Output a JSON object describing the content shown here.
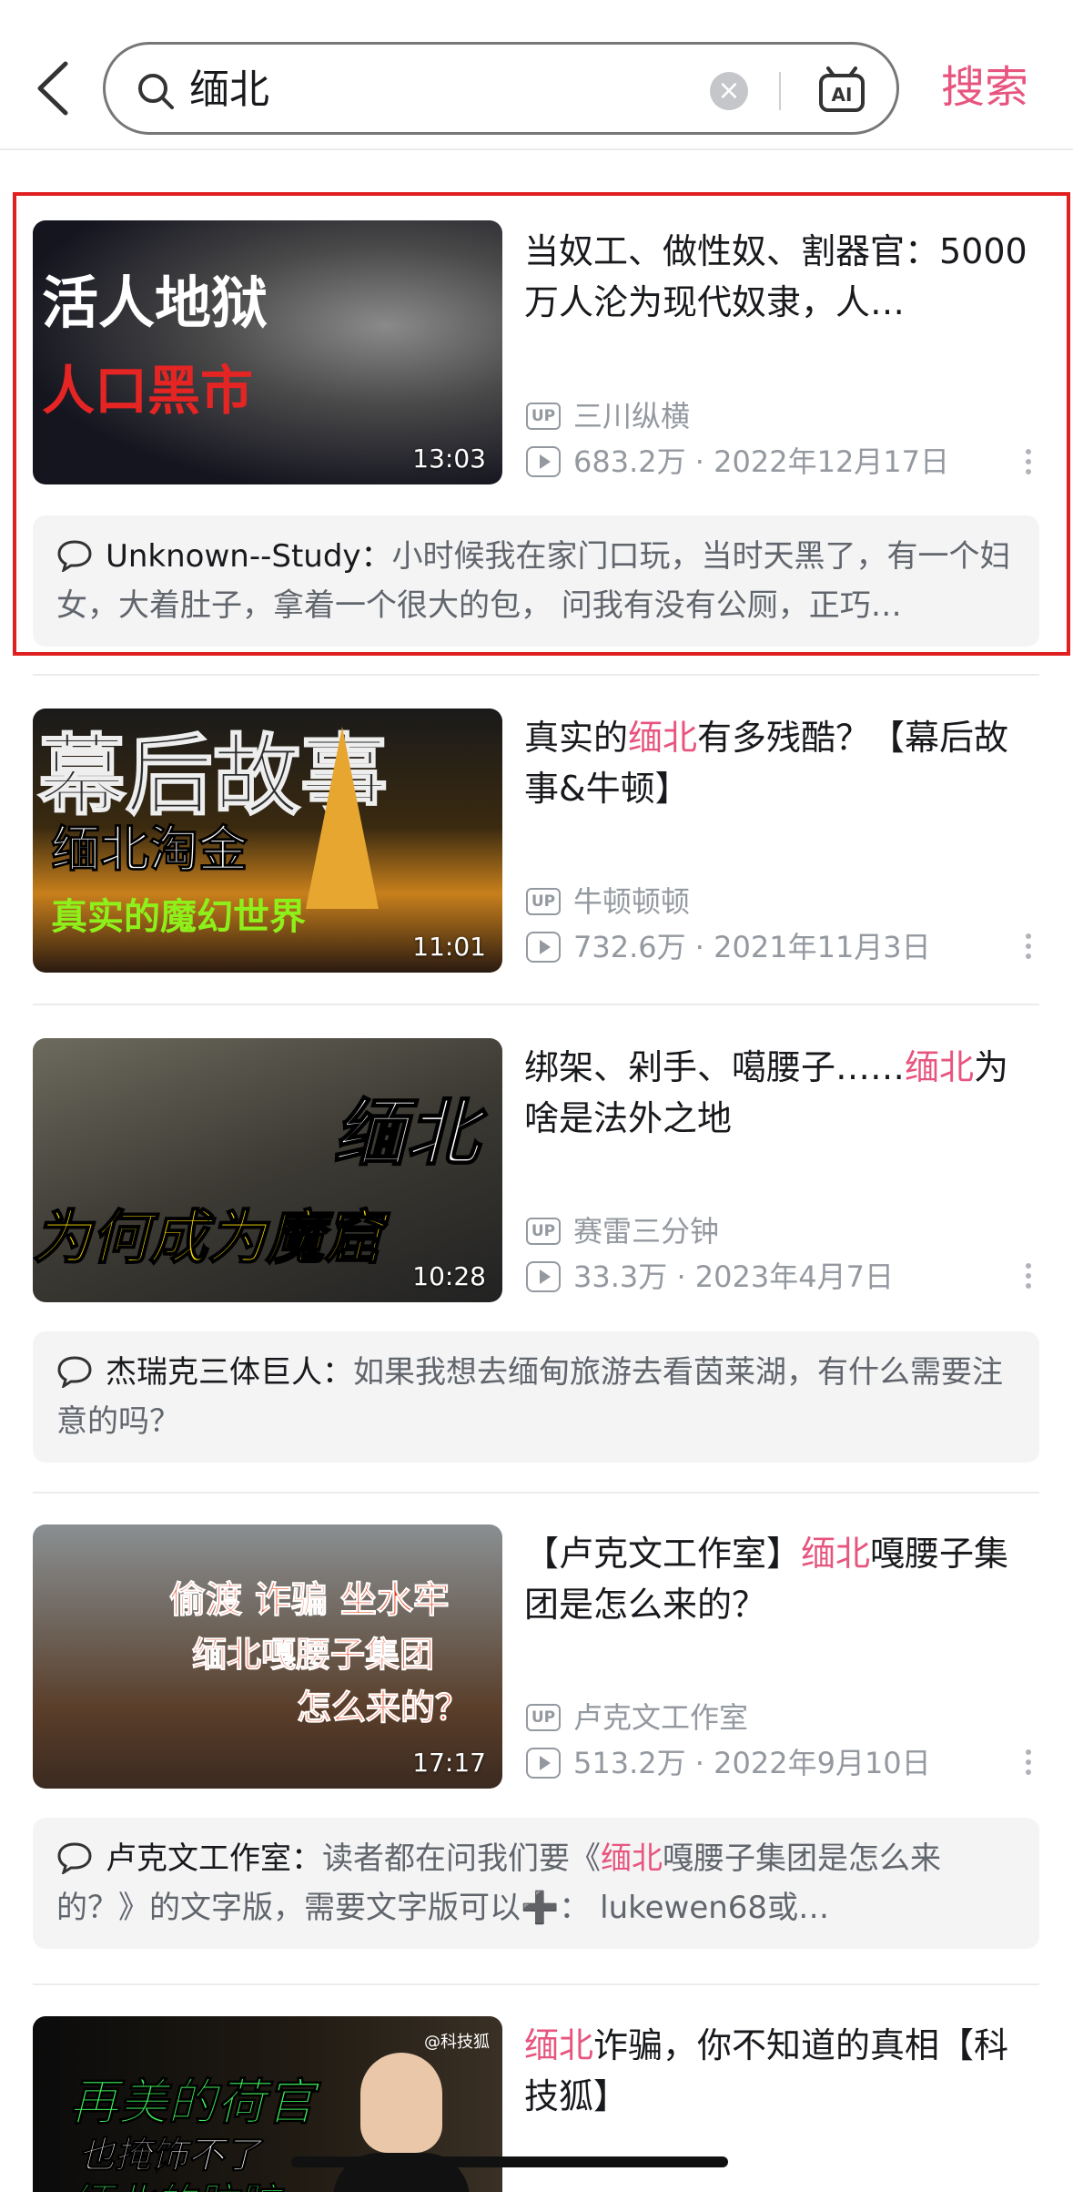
{
  "search": {
    "query": "缅北",
    "submit_label": "搜索",
    "ai_label": "AI"
  },
  "videos": [
    {
      "thumb_text": [
        "活人地狱",
        "人口黑市"
      ],
      "duration": "13:03",
      "title_parts": [
        "当奴工、做性奴、割器官：5000万人沦为现代奴隶，人…"
      ],
      "author": "三川纵横",
      "views": "683.2万",
      "date": "2022年12月17日",
      "comment": {
        "user": "Unknown--Study",
        "sep": "：",
        "text": "小时候我在家门口玩，当时天黑了，有一个妇女，大着肚子，拿着一个很大的包， 问我有没有公厕，正巧…"
      }
    },
    {
      "thumb_text": [
        "幕后故事",
        "缅北淘金",
        "真实的魔幻世界"
      ],
      "duration": "11:01",
      "title_pre": "真实的",
      "title_hl": "缅北",
      "title_post": "有多残酷？【幕后故事&牛顿】",
      "author": "牛顿顿顿",
      "views": "732.6万",
      "date": "2021年11月3日"
    },
    {
      "thumb_text": [
        "缅北",
        "为何成为魔窟"
      ],
      "duration": "10:28",
      "title_pre": "绑架、剁手、噶腰子……",
      "title_hl": "缅北",
      "title_post": "为啥是法外之地",
      "author": "赛雷三分钟",
      "views": "33.3万",
      "date": "2023年4月7日",
      "comment": {
        "user": "杰瑞克三体巨人",
        "sep": "：",
        "text": "如果我想去缅甸旅游去看茵莱湖，有什么需要注意的吗？"
      }
    },
    {
      "thumb_text": [
        "偷渡 诈骗 坐水牢",
        "缅北嘎腰子集团",
        "怎么来的？"
      ],
      "duration": "17:17",
      "title_pre": "【卢克文工作室】",
      "title_hl": "缅北",
      "title_post": "嘎腰子集团是怎么来的？",
      "author": "卢克文工作室",
      "views": "513.2万",
      "date": "2022年9月10日",
      "comment": {
        "user": "卢克文工作室",
        "sep": "：",
        "text_pre": "读者都在问我们要《",
        "text_hl": "缅北",
        "text_post": "嘎腰子集团是怎么来的？》的文字版，需要文字版可以➕： lukewen68或…"
      }
    },
    {
      "thumb_text": [
        "再美的荷官",
        "也掩饰不了",
        "缅北的肮脏",
        "@科技狐"
      ],
      "title_hl": "缅北",
      "title_post": "诈骗，你不知道的真相【科技狐】"
    }
  ],
  "colors": {
    "accent": "#e7557f",
    "highlight_box": "#e02020"
  },
  "icons": [
    "back-arrow-icon",
    "search-icon",
    "clear-icon",
    "ai-icon",
    "up-icon",
    "play-icon",
    "more-icon",
    "comment-icon"
  ]
}
